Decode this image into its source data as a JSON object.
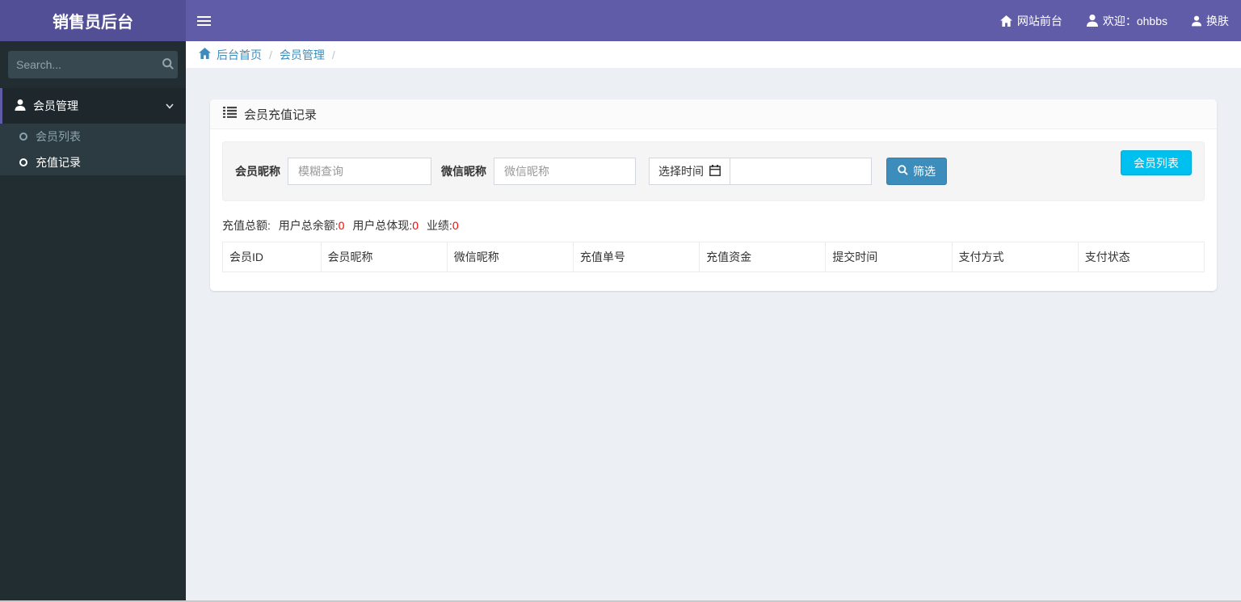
{
  "header": {
    "title": "销售员后台",
    "site_front": "网站前台",
    "welcome": "欢迎：ohbbs",
    "change_skin": "换肤"
  },
  "sidebar": {
    "search_placeholder": "Search...",
    "menu": {
      "member_management": "会员管理"
    },
    "submenu": {
      "member_list": "会员列表",
      "recharge_records": "充值记录"
    }
  },
  "breadcrumb": {
    "home": "后台首页",
    "section": "会员管理",
    "separator": "/"
  },
  "panel": {
    "title": "会员充值记录"
  },
  "filter": {
    "member_nickname_label": "会员昵称",
    "member_nickname_placeholder": "模糊查询",
    "wechat_nickname_label": "微信昵称",
    "wechat_nickname_placeholder": "微信昵称",
    "time_label": "选择时间",
    "time_value": "",
    "filter_button": "筛选",
    "member_list_button": "会员列表"
  },
  "stats": {
    "recharge_total_label": "充值总额:",
    "recharge_total_value": "",
    "user_balance_label": "用户总余额:",
    "user_balance_value": "0",
    "user_withdraw_label": "用户总体现:",
    "user_withdraw_value": "0",
    "performance_label": "业绩:",
    "performance_value": "0"
  },
  "table": {
    "headers": [
      "会员ID",
      "会员昵称",
      "微信昵称",
      "充值单号",
      "充值资金",
      "提交时间",
      "支付方式",
      "支付状态"
    ],
    "rows": []
  },
  "icons": {
    "hamburger": "hamburger-icon",
    "site_front": "home-icon",
    "welcome": "user-icon",
    "change_skin": "user-icon",
    "sidebar_search": "search-icon",
    "menu_member_management": "user-icon",
    "menu_expand": "chevron-down-icon",
    "submenu_bullet": "circle-o-icon",
    "breadcrumb_home": "home-icon",
    "panel_title": "list-icon",
    "time_addon": "calendar-icon",
    "filter_button": "search-icon"
  },
  "colors": {
    "navbar_purple": "#605ca8",
    "logo_purple": "#534f96",
    "sidebar_dark": "#222d32",
    "submenu_dark": "#2c3b41",
    "link_blue": "#3c8dbc",
    "filter_button_blue": "#3c8dbc",
    "member_list_button_cyan": "#00c0ef",
    "stat_value_red": "#ff0000",
    "page_background": "#ecf0f5"
  }
}
